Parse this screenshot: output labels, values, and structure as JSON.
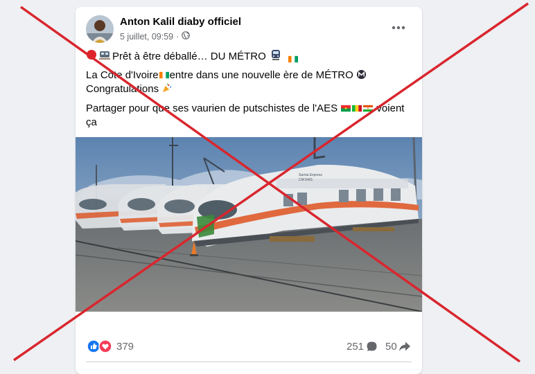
{
  "post": {
    "author": "Anton Kalil diaby officiel",
    "date": "5 juillet, 09:59",
    "separator": "·",
    "audience_icon": "globe-icon",
    "more_icon": "more-options-icon",
    "line1_text": "Prêt à être déballé… DU MÉTRO",
    "line2_prefix": "La Côte d'Ivoire",
    "line2_suffix": "entre dans une nouvelle ère de MÉTRO",
    "line2_end": "Congratulations",
    "line3_prefix": "Partager pour que ses vaurien de putschistes de l'AES",
    "line3_suffix": "voient ça"
  },
  "photo": {
    "train_label_1": "Sarnia Express",
    "train_label_2": "CM 5401"
  },
  "stats": {
    "reaction_count": "379",
    "comment_count": "251",
    "share_count": "50"
  },
  "colors": {
    "cross": "#d9262e",
    "facebook_blue": "#1877f2",
    "love_red": "#f33e58",
    "secondary_text": "#65676b"
  }
}
